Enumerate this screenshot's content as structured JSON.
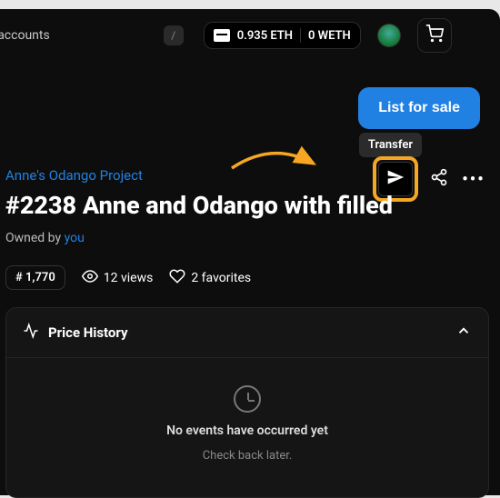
{
  "topbar": {
    "search_placeholder_fragment": "ctions, and accounts",
    "slash_hint": "/",
    "wallet_balance": "0.935 ETH",
    "wallet_secondary": "0 WETH"
  },
  "actions": {
    "list_label": "List for sale",
    "transfer_tooltip": "Transfer"
  },
  "item": {
    "collection_name": "Anne's Odango Project",
    "title": "#2238 Anne and Odango with filled",
    "owned_by_prefix": "Owned by ",
    "owned_by_link": "you"
  },
  "stats": {
    "rank": "# 1,770",
    "views": "12 views",
    "favorites": "2 favorites"
  },
  "price_history": {
    "heading": "Price History",
    "empty_primary": "No events have occurred yet",
    "empty_secondary": "Check back later."
  }
}
